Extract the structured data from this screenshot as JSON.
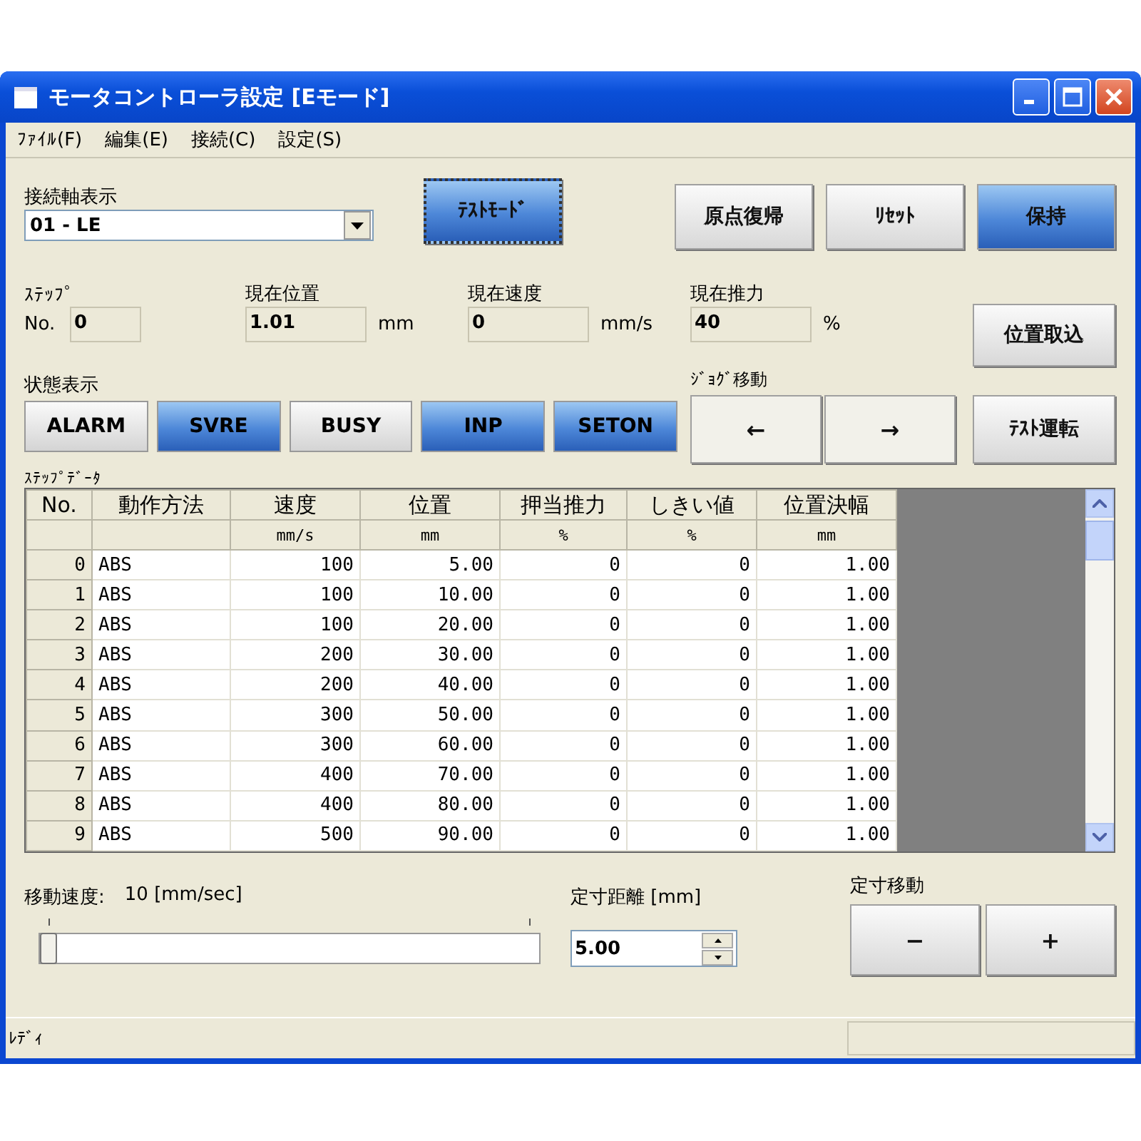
{
  "window": {
    "title": "モータコントローラ設定 [Eモード]"
  },
  "menu": [
    {
      "label": "ﾌｧｲﾙ(F)"
    },
    {
      "label": "編集(E)"
    },
    {
      "label": "接続(C)"
    },
    {
      "label": "設定(S)"
    }
  ],
  "axis": {
    "label": "接続軸表示",
    "value": "01 - LE"
  },
  "top_buttons": [
    {
      "label": "ﾃｽﾄﾓｰﾄﾞ",
      "active": true
    },
    {
      "label": "原点復帰",
      "active": false
    },
    {
      "label": "ﾘｾｯﾄ",
      "active": false
    },
    {
      "label": "保持",
      "active": true
    }
  ],
  "step": {
    "caption": "ｽﾃｯﾌﾟ",
    "label": "No.",
    "value": "0"
  },
  "readouts": [
    {
      "label": "現在位置",
      "value": "1.01",
      "unit": "mm"
    },
    {
      "label": "現在速度",
      "value": "0",
      "unit": "mm/s"
    },
    {
      "label": "現在推力",
      "value": "40",
      "unit": "%"
    }
  ],
  "capture_button": "位置取込",
  "status": {
    "label": "状態表示",
    "indicators": [
      {
        "label": "ALARM",
        "on": false
      },
      {
        "label": "SVRE",
        "on": true
      },
      {
        "label": "BUSY",
        "on": false
      },
      {
        "label": "INP",
        "on": true
      },
      {
        "label": "SETON",
        "on": true
      }
    ]
  },
  "jog": {
    "label": "ｼﾞｮｸﾞ移動",
    "buttons": [
      "←",
      "→"
    ]
  },
  "test_run_button": "ﾃｽﾄ運転",
  "table": {
    "title": "ｽﾃｯﾌﾟﾃﾞｰﾀ",
    "columns": [
      {
        "name": "No."
      },
      {
        "name": "動作方法"
      },
      {
        "name": "速度",
        "unit": "mm/s"
      },
      {
        "name": "位置",
        "unit": "mm"
      },
      {
        "name": "押当推力",
        "unit": "%"
      },
      {
        "name": "しきい値",
        "unit": "%"
      },
      {
        "name": "位置決幅",
        "unit": "mm"
      }
    ],
    "rows": [
      [
        "0",
        "ABS",
        "100",
        "5.00",
        "0",
        "0",
        "1.00"
      ],
      [
        "1",
        "ABS",
        "100",
        "10.00",
        "0",
        "0",
        "1.00"
      ],
      [
        "2",
        "ABS",
        "100",
        "20.00",
        "0",
        "0",
        "1.00"
      ],
      [
        "3",
        "ABS",
        "200",
        "30.00",
        "0",
        "0",
        "1.00"
      ],
      [
        "4",
        "ABS",
        "200",
        "40.00",
        "0",
        "0",
        "1.00"
      ],
      [
        "5",
        "ABS",
        "300",
        "50.00",
        "0",
        "0",
        "1.00"
      ],
      [
        "6",
        "ABS",
        "300",
        "60.00",
        "0",
        "0",
        "1.00"
      ],
      [
        "7",
        "ABS",
        "400",
        "70.00",
        "0",
        "0",
        "1.00"
      ],
      [
        "8",
        "ABS",
        "400",
        "80.00",
        "0",
        "0",
        "1.00"
      ],
      [
        "9",
        "ABS",
        "500",
        "90.00",
        "0",
        "0",
        "1.00"
      ]
    ]
  },
  "speed": {
    "label": "移動速度:",
    "reading": "10 [mm/sec]",
    "level": 0
  },
  "distance": {
    "label": "定寸距離 [mm]",
    "value": "5.00"
  },
  "fixed_move": {
    "label": "定寸移動",
    "buttons": [
      "−",
      "+"
    ]
  },
  "status_bar": "ﾚﾃﾞｨ"
}
